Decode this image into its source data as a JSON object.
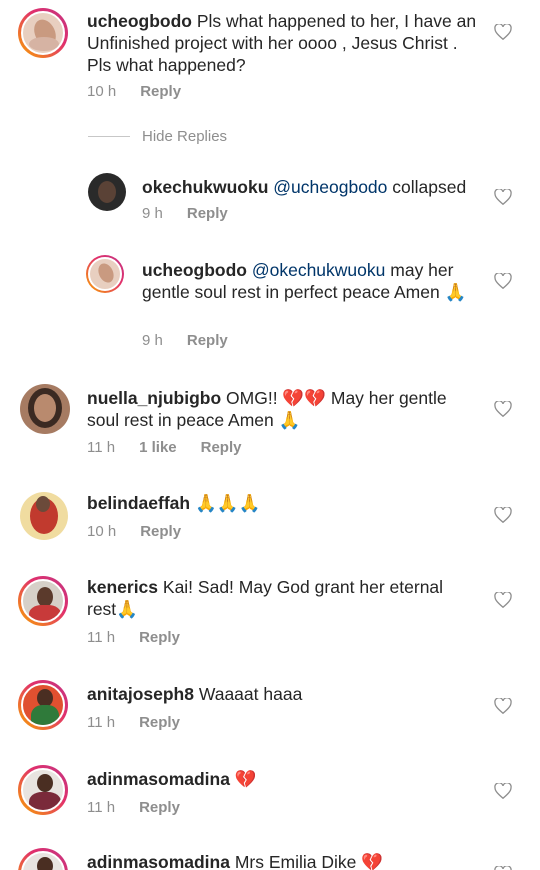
{
  "comments": [
    {
      "username": "ucheogbodo",
      "text": " Pls what happened to her, I have an Unfinished project with her oooo , Jesus Christ . Pls what happened?",
      "time": "10 h",
      "reply_label": "Reply"
    },
    {
      "username": "nuella_njubigbo",
      "text": " OMG!! 💔💔 May her gentle soul rest in peace Amen 🙏",
      "time": "11 h",
      "likes": "1 like",
      "reply_label": "Reply"
    },
    {
      "username": "belindaeffah",
      "text": " 🙏🙏🙏",
      "time": "10 h",
      "reply_label": "Reply"
    },
    {
      "username": "kenerics",
      "text": " Kai! Sad! May God grant her eternal rest🙏",
      "time": "11 h",
      "reply_label": "Reply"
    },
    {
      "username": "anitajoseph8",
      "text": " Waaaat haaa",
      "time": "11 h",
      "reply_label": "Reply"
    },
    {
      "username": "adinmasomadina",
      "text": " 💔",
      "time": "11 h",
      "reply_label": "Reply"
    },
    {
      "username": "adinmasomadina",
      "text": " Mrs Emilia Dike 💔"
    }
  ],
  "hide_replies_label": "Hide Replies",
  "replies": [
    {
      "username": "okechukwuoku",
      "mention": " @ucheogbodo",
      "text": " collapsed",
      "time": "9 h",
      "reply_label": "Reply"
    },
    {
      "username": "ucheogbodo",
      "mention": " @okechukwuoku",
      "text": " may her gentle soul rest in perfect peace Amen 🙏",
      "time": "9 h",
      "reply_label": "Reply"
    }
  ],
  "colors": {
    "ring_gradient": [
      "#f9a400",
      "#e1306c",
      "#c13584"
    ],
    "mention": "#003569",
    "meta": "#8e8e8e"
  }
}
